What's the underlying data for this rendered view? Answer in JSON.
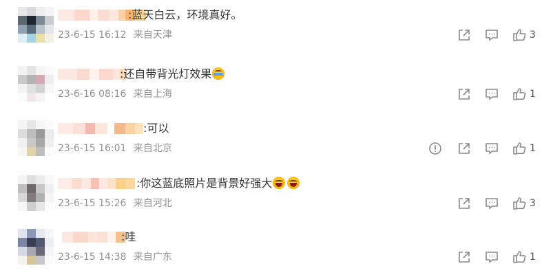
{
  "comments": [
    {
      "text": ":蓝天白云，环境真好。",
      "emojis": [],
      "date": "23-6-15 16:12",
      "location": "来自天津",
      "likes": "3",
      "report": false
    },
    {
      "text": ":还自带背光灯效果",
      "emojis": [
        "light-emoji"
      ],
      "date": "23-6-16 08:16",
      "location": "来自上海",
      "likes": "1",
      "report": false
    },
    {
      "text": ":可以",
      "emojis": [],
      "date": "23-6-15 16:01",
      "location": "来自北京",
      "likes": "1",
      "report": true
    },
    {
      "text": ":你这蓝底照片是背景好强大",
      "emojis": [
        "laugh-emoji",
        "laugh-emoji"
      ],
      "date": "23-6-15 15:26",
      "location": "来自河北",
      "likes": "3",
      "report": false
    },
    {
      "text": ":哇",
      "emojis": [],
      "date": "23-6-15 14:38",
      "location": "来自广东",
      "likes": "1",
      "report": false
    }
  ],
  "icons": {
    "report": "exclamation-circle-icon",
    "share": "share-icon",
    "comment": "comment-icon",
    "like": "thumbs-up-icon"
  },
  "colors": {
    "text": "#333333",
    "meta": "#939393",
    "icon": "#8a8a8a",
    "background": "#ffffff"
  }
}
